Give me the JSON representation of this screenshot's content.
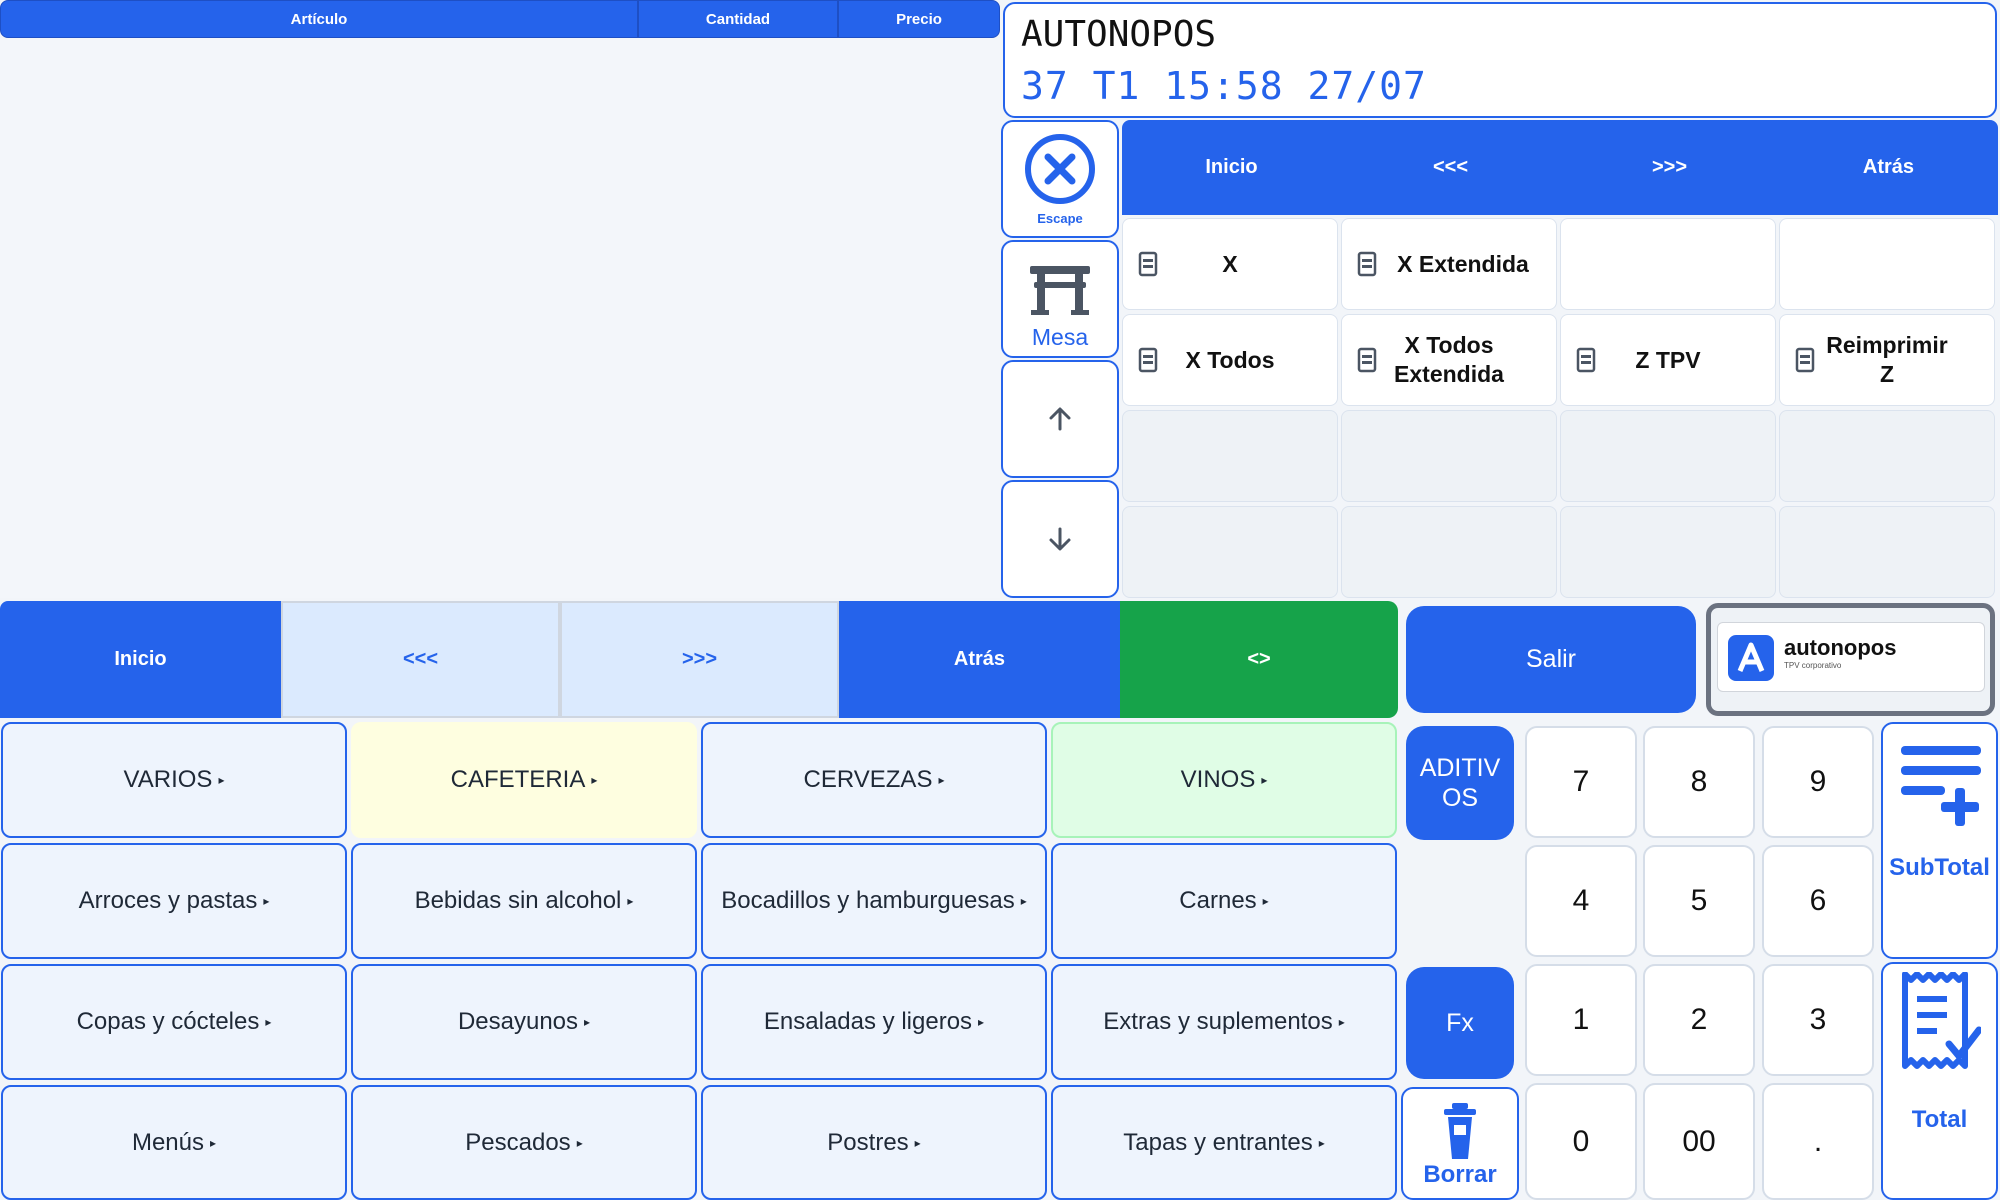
{
  "ticket": {
    "col_articulo": "Artículo",
    "col_cantidad": "Cantidad",
    "col_precio": "Precio"
  },
  "display": {
    "line1": "AUTONOPOS",
    "line2": "37  T1  15:58  27/07"
  },
  "side": {
    "escape_label": "Escape",
    "mesa_label": "Mesa"
  },
  "report_nav": {
    "inicio": "Inicio",
    "prev": "<<<",
    "next": ">>>",
    "atras": "Atrás"
  },
  "reports": [
    {
      "label": "X"
    },
    {
      "label": "X Extendida"
    },
    {
      "label": "X Todos"
    },
    {
      "label": "X Todos Extendida"
    },
    {
      "label": "Z TPV"
    },
    {
      "label": "Reimprimir Z"
    }
  ],
  "family_nav": {
    "inicio": "Inicio",
    "prev": "<<<",
    "next": ">>>",
    "atras": "Atrás",
    "toggle": "<>"
  },
  "salir_label": "Salir",
  "logo": {
    "brand": "autonopos",
    "tagline": "TPV corporativo"
  },
  "categories": [
    {
      "label": "VARIOS",
      "color": "#eef4fd"
    },
    {
      "label": "CAFETERIA",
      "color": "#fefee0"
    },
    {
      "label": "CERVEZAS",
      "color": "#eef4fd"
    },
    {
      "label": "VINOS",
      "color": "#e0fde6"
    },
    {
      "label": "Arroces y pastas",
      "color": "#eef4fd"
    },
    {
      "label": "Bebidas sin alcohol",
      "color": "#eef4fd"
    },
    {
      "label": "Bocadillos y hamburguesas",
      "color": "#eef4fd"
    },
    {
      "label": "Carnes",
      "color": "#eef4fd"
    },
    {
      "label": "Copas y cócteles",
      "color": "#eef4fd"
    },
    {
      "label": "Desayunos",
      "color": "#eef4fd"
    },
    {
      "label": "Ensaladas y ligeros",
      "color": "#eef4fd"
    },
    {
      "label": "Extras y suplementos",
      "color": "#eef4fd"
    },
    {
      "label": "Menús",
      "color": "#eef4fd"
    },
    {
      "label": "Pescados",
      "color": "#eef4fd"
    },
    {
      "label": "Postres",
      "color": "#eef4fd"
    },
    {
      "label": "Tapas y entrantes",
      "color": "#eef4fd"
    }
  ],
  "aditivos_label": "ADITIV OS",
  "fx_label": "Fx",
  "borrar_label": "Borrar",
  "keypad": {
    "k7": "7",
    "k8": "8",
    "k9": "9",
    "k4": "4",
    "k5": "5",
    "k6": "6",
    "k1": "1",
    "k2": "2",
    "k3": "3",
    "k0": "0",
    "k00": "00",
    "kdot": "."
  },
  "subtotal_label": "SubTotal",
  "total_label": "Total",
  "colors": {
    "primary": "#2563eb",
    "toggle": "#16a34a",
    "vinos": "#e0fde6",
    "cafeteria": "#fefee0"
  }
}
